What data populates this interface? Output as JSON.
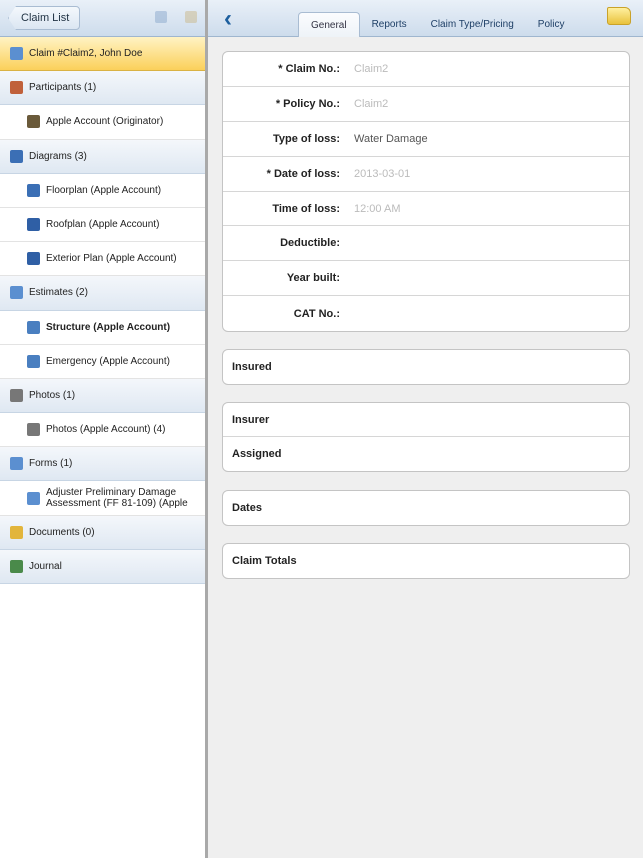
{
  "sidebar": {
    "back_label": "Claim List",
    "items": [
      {
        "label": "Claim #Claim2, John Doe",
        "type": "active",
        "icon": "document-icon",
        "color": "#5b8fd0"
      },
      {
        "label": "Participants (1)",
        "type": "sec",
        "icon": "people-icon",
        "color": "#c0603a"
      },
      {
        "label": "Apple Account (Originator)",
        "type": "child",
        "icon": "person-icon",
        "color": "#6a5a3a"
      },
      {
        "label": "Diagrams (3)",
        "type": "sec",
        "icon": "diagram-icon",
        "color": "#3b6fb5"
      },
      {
        "label": "Floorplan (Apple Account)",
        "type": "child",
        "icon": "floorplan-icon",
        "color": "#3b6fb5"
      },
      {
        "label": "Roofplan (Apple Account)",
        "type": "child",
        "icon": "roofplan-icon",
        "color": "#2f5fa5"
      },
      {
        "label": "Exterior Plan (Apple Account)",
        "type": "child",
        "icon": "house-icon",
        "color": "#2f5fa5"
      },
      {
        "label": "Estimates (2)",
        "type": "sec",
        "icon": "estimate-icon",
        "color": "#5b8fd0"
      },
      {
        "label": "Structure (Apple Account)",
        "type": "child bold",
        "icon": "edit-icon",
        "color": "#4a7fc0"
      },
      {
        "label": "Emergency (Apple Account)",
        "type": "child",
        "icon": "edit-icon",
        "color": "#4a7fc0"
      },
      {
        "label": "Photos (1)",
        "type": "sec",
        "icon": "camera-icon",
        "color": "#777777"
      },
      {
        "label": "Photos (Apple Account) (4)",
        "type": "child",
        "icon": "camera-icon",
        "color": "#777777"
      },
      {
        "label": "Forms (1)",
        "type": "sec",
        "icon": "form-icon",
        "color": "#5b8fd0"
      },
      {
        "label": "Adjuster Preliminary Damage Assessment (FF 81-109) (Apple",
        "type": "child two",
        "icon": "form-icon",
        "color": "#5b8fd0"
      },
      {
        "label": "Documents (0)",
        "type": "sec",
        "icon": "folder-icon",
        "color": "#e2b53c"
      },
      {
        "label": "Journal",
        "type": "sec",
        "icon": "journal-icon",
        "color": "#4a8a4a"
      }
    ]
  },
  "tabs": [
    {
      "label": "General",
      "active": true
    },
    {
      "label": "Reports"
    },
    {
      "label": "Claim Type/Pricing"
    },
    {
      "label": "Policy"
    }
  ],
  "form": [
    {
      "label": "* Claim No.:",
      "value": "Claim2",
      "placeholder": true
    },
    {
      "label": "* Policy No.:",
      "value": "Claim2",
      "placeholder": true
    },
    {
      "label": "Type of loss:",
      "value": "Water Damage"
    },
    {
      "label": "* Date of loss:",
      "value": "2013-03-01",
      "placeholder": true
    },
    {
      "label": "Time of loss:",
      "value": "12:00 AM",
      "placeholder": true
    },
    {
      "label": "Deductible:",
      "value": ""
    },
    {
      "label": "Year built:",
      "value": ""
    },
    {
      "label": "CAT No.:",
      "value": ""
    }
  ],
  "sections": {
    "insured": "Insured",
    "insurer": "Insurer",
    "assigned": "Assigned",
    "dates": "Dates",
    "claim_totals": "Claim Totals"
  }
}
